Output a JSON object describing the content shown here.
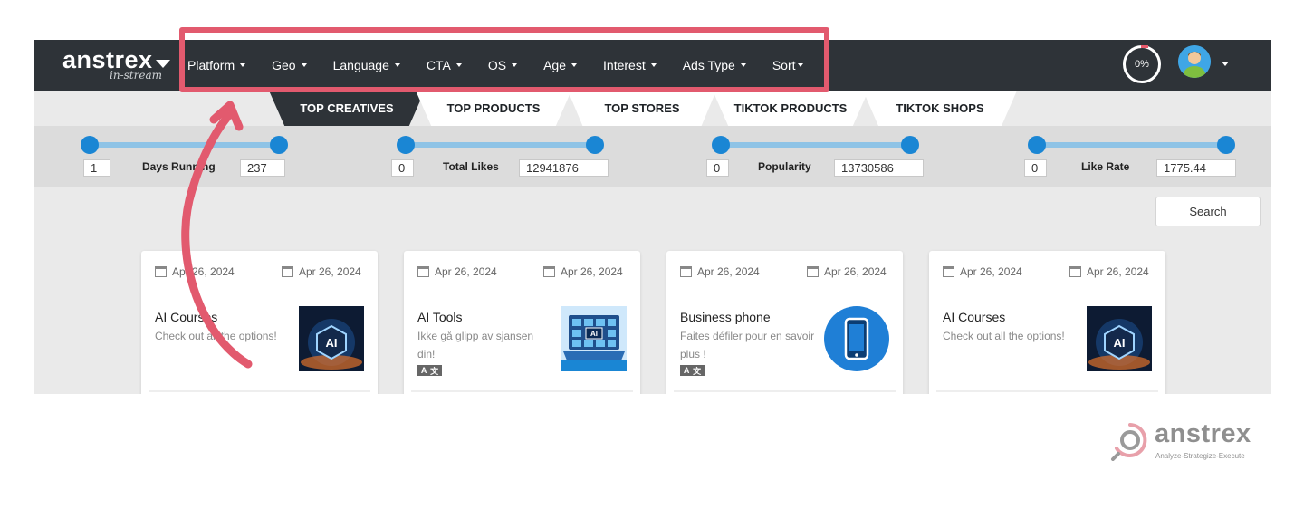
{
  "brand": {
    "name": "anstrex",
    "sub": "in-stream"
  },
  "menu": [
    "Platform",
    "Geo",
    "Language",
    "CTA",
    "OS",
    "Age",
    "Interest",
    "Ads Type",
    "Sort"
  ],
  "progress": {
    "label": "0%",
    "value": 0
  },
  "tabs": [
    {
      "label": "TOP CREATIVES",
      "active": true
    },
    {
      "label": "TOP PRODUCTS",
      "active": false
    },
    {
      "label": "TOP STORES",
      "active": false
    },
    {
      "label": "TIKTOK PRODUCTS",
      "active": false
    },
    {
      "label": "TIKTOK SHOPS",
      "active": false
    }
  ],
  "filters": [
    {
      "label": "Days Running",
      "min": "1",
      "max": "237"
    },
    {
      "label": "Total Likes",
      "min": "0",
      "max": "12941876"
    },
    {
      "label": "Popularity",
      "min": "0",
      "max": "13730586"
    },
    {
      "label": "Like Rate",
      "min": "0",
      "max": "1775.44"
    }
  ],
  "search_label": "Search",
  "cards": [
    {
      "date_start": "Apr 26, 2024",
      "date_end": "Apr 26, 2024",
      "title": "AI Courses",
      "text": "Check out all the options!",
      "translate": false,
      "thumb": "ai-chip"
    },
    {
      "date_start": "Apr 26, 2024",
      "date_end": "Apr 26, 2024",
      "title": "AI Tools",
      "text": "Ikke gå glipp av sjansen din!",
      "translate": true,
      "thumb": "ai-laptop"
    },
    {
      "date_start": "Apr 26, 2024",
      "date_end": "Apr 26, 2024",
      "title": "Business phone",
      "text": "Faites défiler pour en savoir plus !",
      "translate": true,
      "thumb": "phone"
    },
    {
      "date_start": "Apr 26, 2024",
      "date_end": "Apr 26, 2024",
      "title": "AI Courses",
      "text": "Check out all the options!",
      "translate": false,
      "thumb": "ai-chip"
    }
  ],
  "watermark": {
    "name": "anstrex",
    "tagline": "Analyze-Strategize-Execute"
  },
  "colors": {
    "nav": "#2e3338",
    "accent": "#1a86d4",
    "annotation": "#e25a6e"
  }
}
